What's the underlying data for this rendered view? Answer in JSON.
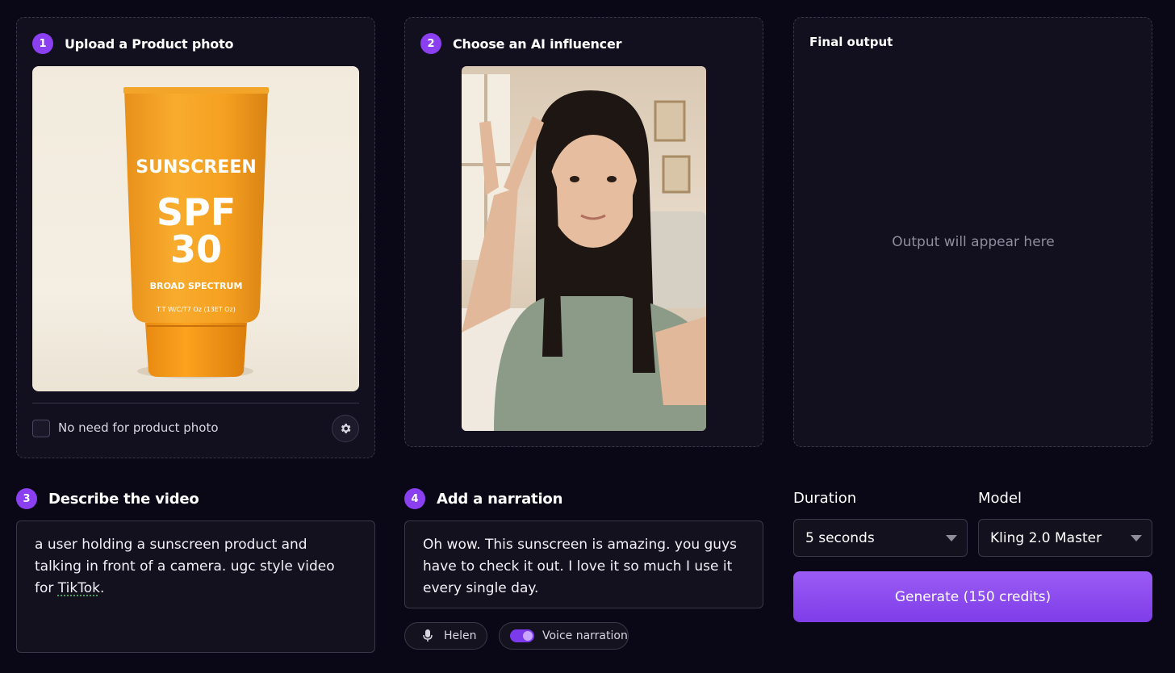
{
  "steps": {
    "upload": {
      "num": "1",
      "title": "Upload a Product photo"
    },
    "influencer": {
      "num": "2",
      "title": "Choose an AI influencer"
    },
    "describe": {
      "num": "3",
      "title": "Describe the video"
    },
    "narration": {
      "num": "4",
      "title": "Add a narration"
    }
  },
  "product": {
    "brand_text": "SUNSCREEN",
    "spf_line1": "SPF",
    "spf_line2": "30",
    "tagline": "BROAD SPECTRUM",
    "fine_print": "T.T W/C/T7 Oz (13ET Oz)",
    "bottle_color": "#f5a623"
  },
  "no_photo": {
    "label": "No need for product photo",
    "checked": false
  },
  "output": {
    "title": "Final output",
    "placeholder": "Output will appear here"
  },
  "description": {
    "text_before": "a user holding a sunscreen product and talking in front of a camera. ugc style video for ",
    "text_flagged": "TikTok",
    "text_after": "."
  },
  "narration": {
    "text": "Oh wow. This sunscreen is amazing. you guys have to check it out. I love it so much I use it every single day.",
    "voice_label": "Helen",
    "toggle_label": "Voice narration",
    "toggle_on": true
  },
  "duration": {
    "label": "Duration",
    "value": "5 seconds"
  },
  "model": {
    "label": "Model",
    "value": "Kling 2.0 Master"
  },
  "generate": {
    "label": "Generate (150 credits)"
  },
  "colors": {
    "accent": "#8a3ff0",
    "background": "#0a0816",
    "card": "#120f1f"
  }
}
